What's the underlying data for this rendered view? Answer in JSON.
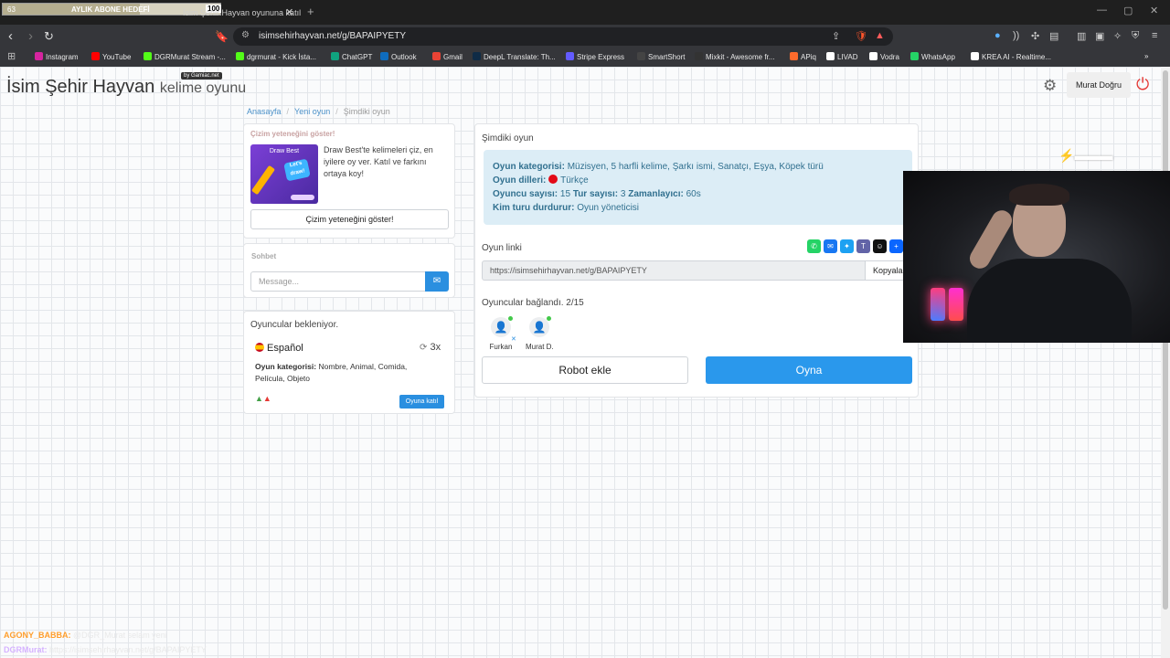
{
  "overlay": {
    "goal_label": "AYLIK ABONE HEDEFİ",
    "goal_current": "63",
    "goal_target": "100",
    "goal_progress": 0.63,
    "chat": [
      {
        "user": "AGONY_BABBA:",
        "message": "@DGR_Murat selam yeni"
      },
      {
        "user": "DGRMurat:",
        "message": "https://isimsehirhayvan.net/g/BAPAIPYETY"
      }
    ]
  },
  "browser": {
    "tab_title": "İsim Şehir Hayvan oyununa katıl",
    "url": "isimsehirhayvan.net/g/BAPAIPYETY",
    "bookmarks": [
      {
        "label": "Instagram",
        "color": "#d6249f"
      },
      {
        "label": "YouTube",
        "color": "#ff0000"
      },
      {
        "label": "DGRMurat Stream -...",
        "color": "#53fc18"
      },
      {
        "label": "dgrmurat - Kick İsta...",
        "color": "#53fc18"
      },
      {
        "label": "ChatGPT",
        "color": "#10a37f"
      },
      {
        "label": "Outlook",
        "color": "#0f6cbd"
      },
      {
        "label": "Gmail",
        "color": "#ea4335"
      },
      {
        "label": "DeepL Translate: Th...",
        "color": "#0f2b46"
      },
      {
        "label": "Stripe Express",
        "color": "#635bff"
      },
      {
        "label": "SmartShort",
        "color": "#444444"
      },
      {
        "label": "Mixkit - Awesome fr...",
        "color": "#333333"
      },
      {
        "label": "APiq",
        "color": "#ff6b2c"
      },
      {
        "label": "LIVAD",
        "color": "#ffffff"
      },
      {
        "label": "Vodra",
        "color": "#ffffff"
      },
      {
        "label": "WhatsApp",
        "color": "#25d366"
      },
      {
        "label": "KREA AI - Realtime...",
        "color": "#ffffff"
      }
    ]
  },
  "site": {
    "brand": "İsim Şehir Hayvan",
    "brand_sub": "kelime oyunu",
    "byline": "by Gamiac.net",
    "user_button": "Murat Doğru"
  },
  "breadcrumb": {
    "home": "Anasayfa",
    "new_game": "Yeni oyun",
    "current": "Şimdiki oyun"
  },
  "draw_card": {
    "header": "Çizim yeteneğini göster!",
    "thumb_title": "Draw Best",
    "thumb_badge": "Let's draw!",
    "text": "Draw Best'te kelimeleri çiz, en iyilere oy ver. Katıl ve farkını ortaya koy!",
    "button": "Çizim yeteneğini göster!"
  },
  "chat_card": {
    "header": "Sohbet",
    "placeholder": "Message..."
  },
  "waiting": {
    "title": "Oyuncular bekleniyor.",
    "language": "Español",
    "rounds": "3x",
    "category_label": "Oyun kategorisi:",
    "category_value": "Nombre, Animal, Comida, Película, Objeto",
    "join_button": "Oyuna katıl"
  },
  "game": {
    "header": "Şimdiki oyun",
    "category_label": "Oyun kategorisi:",
    "category_value": "Müzisyen, 5 harfli kelime, Şarkı ismi, Sanatçı, Eşya, Köpek türü",
    "languages_label": "Oyun dilleri:",
    "languages_value": "Türkçe",
    "players_label": "Oyuncu sayısı:",
    "players_value": "15",
    "turns_label": "Tur sayısı:",
    "turns_value": "3",
    "timer_label": "Zamanlayıcı:",
    "timer_value": "60s",
    "stopper_label": "Kim turu durdurur:",
    "stopper_value": "Oyun yöneticisi",
    "link_label": "Oyun linki",
    "link_value": "https://isimsehirhayvan.net/g/BAPAIPYETY",
    "copy_button": "Kopyala",
    "connected_label": "Oyuncular bağlandı. 2/15",
    "players": [
      {
        "name": "Furkan"
      },
      {
        "name": "Murat D."
      }
    ],
    "robot_button": "Robot ekle",
    "play_button": "Oyna"
  },
  "colors": {
    "accent": "#2a98ec",
    "info_bg": "#dcedf6",
    "danger": "#e53935"
  }
}
